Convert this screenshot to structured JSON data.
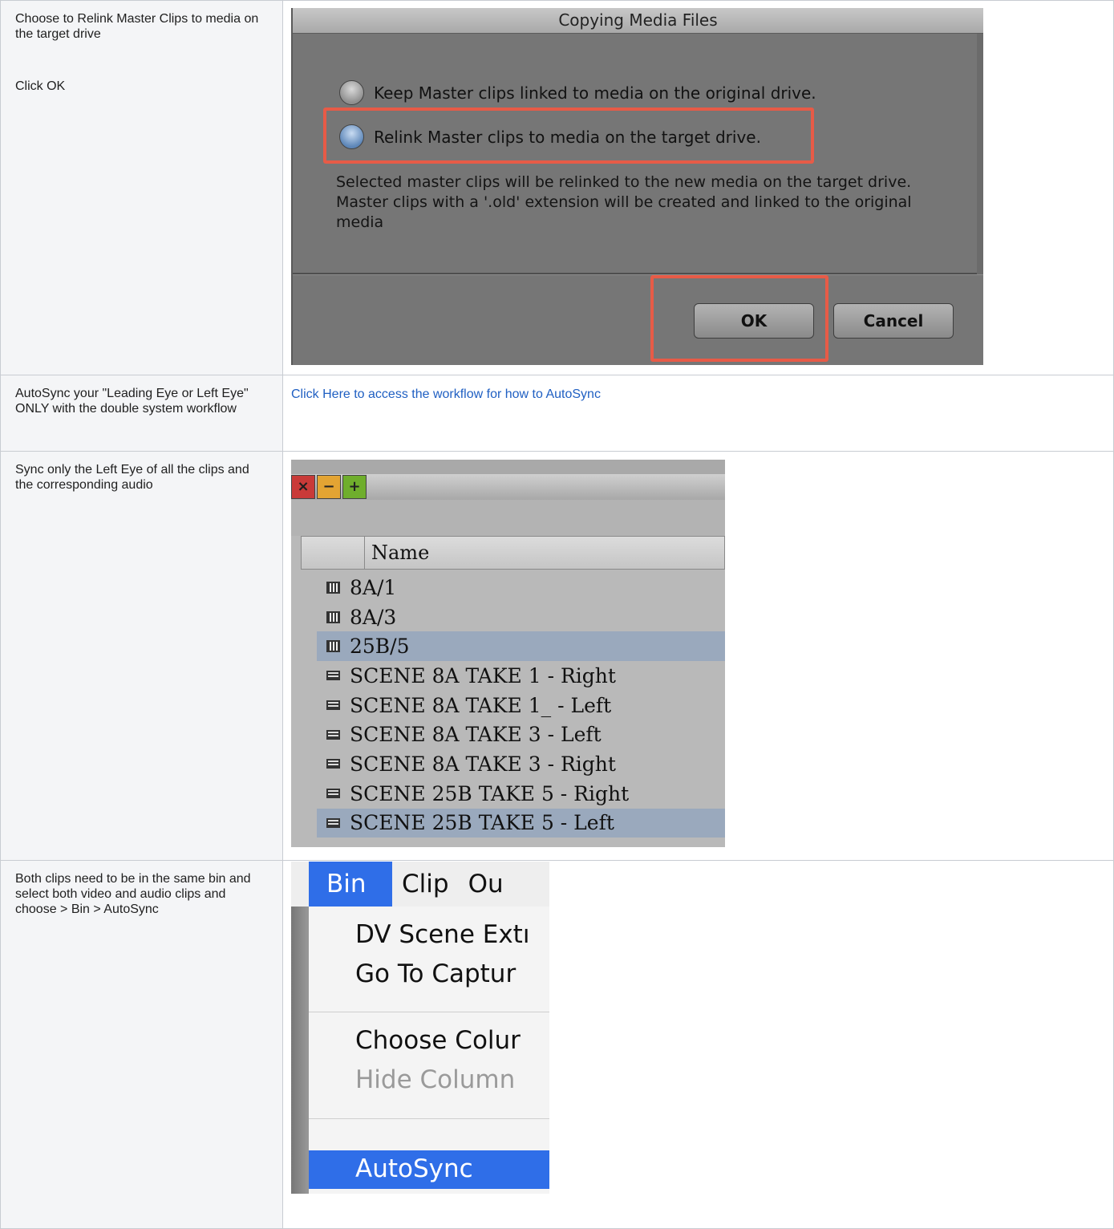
{
  "rows": [
    {
      "instruction": [
        "Choose to Relink Master Clips to media on the target drive",
        "Click OK"
      ],
      "dialog": {
        "title": "Copying Media Files",
        "option_keep": "Keep Master clips linked to media on the original drive.",
        "option_relink": "Relink Master clips to media on the target drive.",
        "description": "Selected master clips will be relinked to the new media on the target drive.  Master clips with a '.old' extension will be created and linked to the original media",
        "ok_label": "OK",
        "cancel_label": "Cancel",
        "highlight_color": "#e75b47"
      }
    },
    {
      "instruction": "AutoSync your \"Leading Eye or Left Eye\" ONLY with the double system workflow",
      "link_text": "Click Here to access the workflow for how to AutoSync"
    },
    {
      "instruction": "Sync only the Left Eye of all the clips and the corresponding audio",
      "bin": {
        "window_buttons": [
          "×",
          "−",
          "+"
        ],
        "column_header": "Name",
        "clips": [
          {
            "name": "8A/1",
            "icon": "audio-clip-icon",
            "selected": false
          },
          {
            "name": "8A/3",
            "icon": "audio-clip-icon",
            "selected": false
          },
          {
            "name": "25B/5",
            "icon": "audio-clip-icon",
            "selected": true
          },
          {
            "name": "SCENE 8A TAKE 1 - Right",
            "icon": "video-clip-icon",
            "selected": false
          },
          {
            "name": "SCENE 8A TAKE 1_ - Left",
            "icon": "video-clip-icon",
            "selected": false
          },
          {
            "name": "SCENE 8A TAKE 3 - Left",
            "icon": "video-clip-icon",
            "selected": false
          },
          {
            "name": "SCENE 8A TAKE 3 - Right",
            "icon": "video-clip-icon",
            "selected": false
          },
          {
            "name": "SCENE 25B TAKE 5 - Right",
            "icon": "video-clip-icon",
            "selected": false
          },
          {
            "name": "SCENE 25B TAKE 5 - Left",
            "icon": "video-clip-icon",
            "selected": true
          }
        ],
        "selection_color": "#9aa9bd"
      }
    },
    {
      "instruction": "Both clips need to be in the same bin and select both video and audio clips and choose > Bin > AutoSync",
      "menu": {
        "menubar": [
          "Bin",
          "Clip",
          "Ou"
        ],
        "items": [
          "DV Scene Extı",
          "Go To Captur",
          "Choose Colur",
          "Hide Column",
          "AutoSync"
        ],
        "disabled_item": "Hide Column",
        "active_item": "AutoSync",
        "accent": "#2f6ee8"
      }
    }
  ]
}
